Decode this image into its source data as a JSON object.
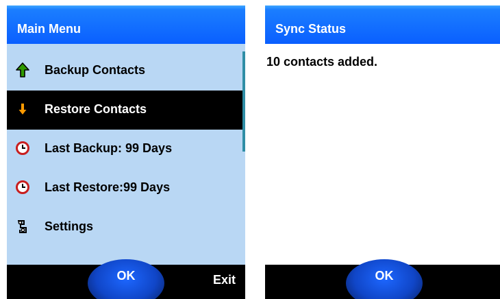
{
  "left_screen": {
    "title": "Main Menu",
    "menu_items": [
      {
        "label": "Backup Contacts",
        "icon": "green-up-arrow-icon"
      },
      {
        "label": "Restore Contacts",
        "icon": "orange-down-arrow-icon",
        "selected": true
      },
      {
        "label": "Last Backup: 99 Days",
        "icon": "clock-icon"
      },
      {
        "label": "Last Restore:99 Days",
        "icon": "clock-icon"
      },
      {
        "label": "Settings",
        "icon": "settings-icon"
      }
    ],
    "softkeys": {
      "center": "OK",
      "right": "Exit"
    }
  },
  "right_screen": {
    "title": "Sync Status",
    "message": "10 contacts added.",
    "softkeys": {
      "center": "OK"
    }
  },
  "colors": {
    "title_bar": "#0a5fff",
    "menu_background": "#b9d7f4",
    "selected_background": "#000000",
    "up_arrow": "#2f9a00",
    "down_arrow": "#ff9a00",
    "clock": "#c81e1e"
  }
}
